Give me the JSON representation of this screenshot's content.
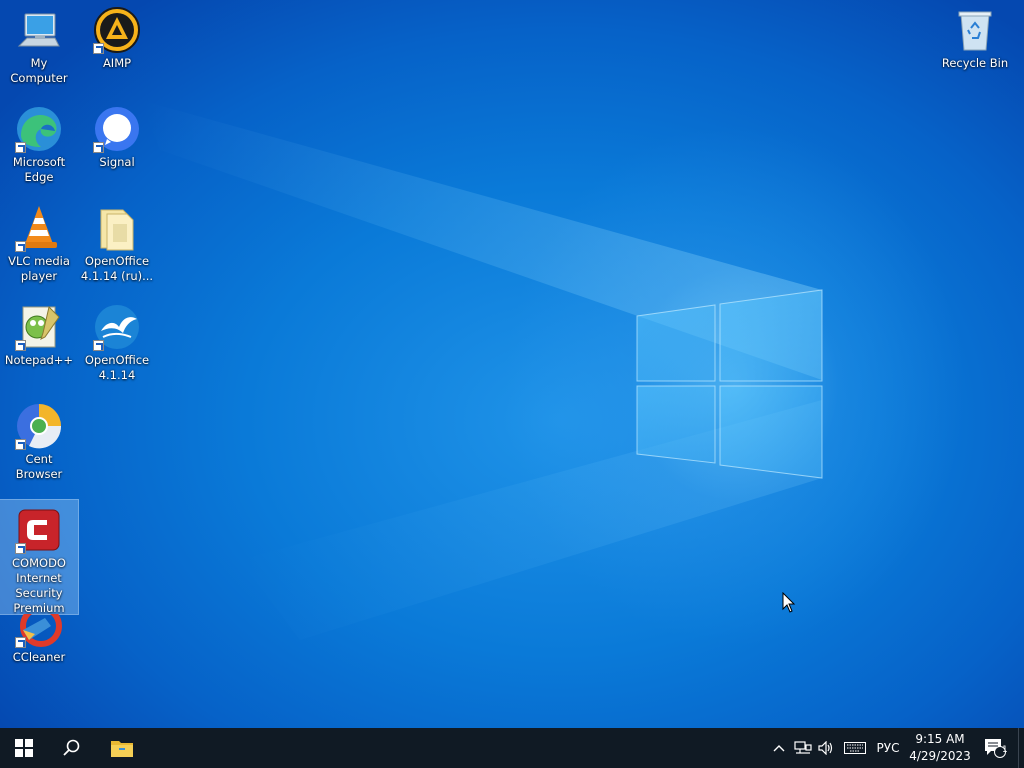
{
  "desktop": {
    "icons": {
      "my_computer": "My Computer",
      "aimp": "AIMP",
      "recycle_bin": "Recycle Bin",
      "edge_line1": "Microsoft",
      "edge_line2": "Edge",
      "signal": "Signal",
      "vlc_line1": "VLC media",
      "vlc_line2": "player",
      "openoffice_folder_line1": "OpenOffice",
      "openoffice_folder_line2": "4.1.14 (ru)...",
      "notepadpp": "Notepad++",
      "openoffice_line1": "OpenOffice",
      "openoffice_line2": "4.1.14",
      "cent_browser": "Cent Browser",
      "comodo_line1": "COMODO",
      "comodo_line2": "Internet",
      "comodo_line3": "Security",
      "comodo_line4": "Premium",
      "ccleaner": "CCleaner"
    }
  },
  "taskbar": {
    "language": "РУС",
    "time": "9:15 AM",
    "date": "4/29/2023",
    "notification_count": "1"
  },
  "icons": [
    "windows-start-icon",
    "search-icon",
    "file-explorer-icon",
    "chevron-up-icon",
    "network-icon",
    "volume-icon",
    "keyboard-icon",
    "action-center-icon"
  ]
}
